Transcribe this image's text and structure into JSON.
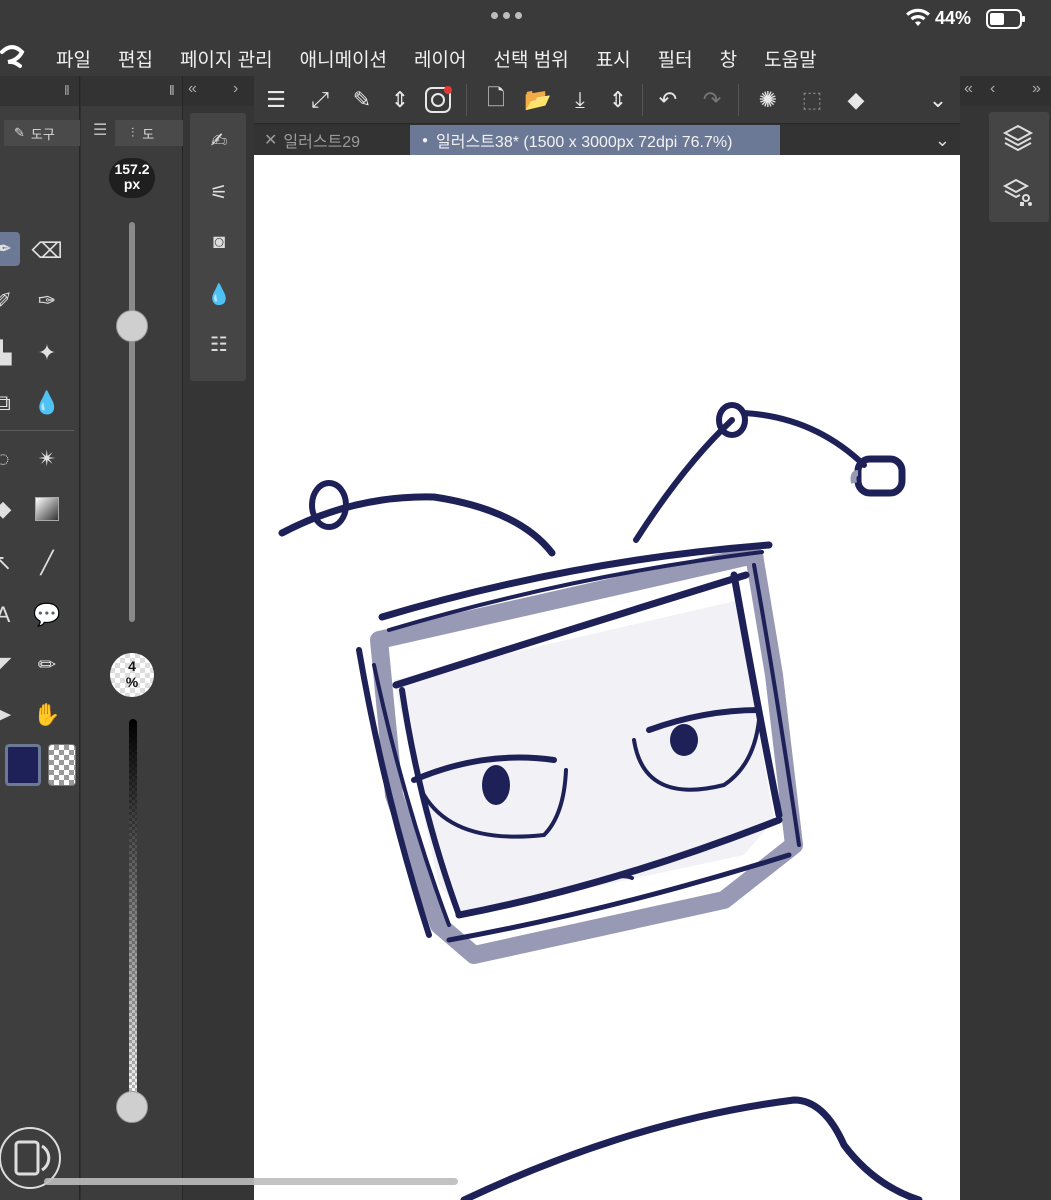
{
  "status_bar": {
    "battery_percent": "44%"
  },
  "menu": {
    "items": [
      "파일",
      "편집",
      "페이지 관리",
      "애니메이션",
      "레이어",
      "선택 범위",
      "표시",
      "필터",
      "창",
      "도움말"
    ]
  },
  "left_panel": {
    "tab_label": "도구"
  },
  "size_panel": {
    "tab_label": "도",
    "brush_size_value": "157.2",
    "brush_size_unit": "px",
    "opacity_value": "4",
    "opacity_unit": "%",
    "brush_size_slider_fraction": 0.26,
    "opacity_slider_fraction": 1.0
  },
  "tabs": [
    {
      "label": "일러스트29",
      "active": false
    },
    {
      "label": "일러스트38* (1500 x 3000px 72dpi 76.7%)",
      "active": true
    }
  ],
  "colors": {
    "main_color": "#1e2157",
    "accent_tab": "#6b7896",
    "stroke_color": "#1e2157",
    "fill_color": "#9899b4"
  }
}
